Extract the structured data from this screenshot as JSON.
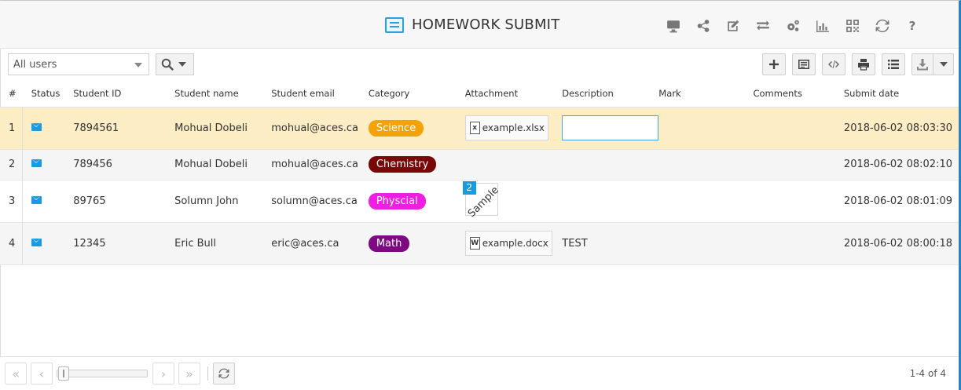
{
  "header": {
    "title": "HOMEWORK SUBMIT",
    "icons": [
      "monitor-icon",
      "share-icon",
      "edit-icon",
      "swap-icon",
      "settings-icon",
      "chart-icon",
      "qrcode-icon",
      "refresh-icon",
      "help-icon"
    ],
    "help_label": "?"
  },
  "toolbar": {
    "user_filter": "All users",
    "right_buttons": [
      "add-icon",
      "form-icon",
      "code-icon",
      "print-icon",
      "list-icon",
      "download-icon"
    ]
  },
  "table": {
    "columns": [
      "#",
      "Status",
      "Student ID",
      "Student name",
      "Student email",
      "Category",
      "Attachment",
      "Description",
      "Mark",
      "Comments",
      "Submit date"
    ],
    "rows": [
      {
        "num": "1",
        "status": "mail-icon",
        "student_id": "7894561",
        "name": "Mohual Dobeli",
        "email": "mohual@aces.ca",
        "category": "Science",
        "category_color": "#f5a20a",
        "attachment": "example.xlsx",
        "attachment_type": "x",
        "description": "",
        "mark": "",
        "comments": "",
        "date": "2018-06-02 08:03:30"
      },
      {
        "num": "2",
        "status": "mail-icon",
        "student_id": "789456",
        "name": "Mohual Dobeli",
        "email": "mohual@aces.ca",
        "category": "Chemistry",
        "category_color": "#7a0707",
        "attachment": "",
        "description": "",
        "mark": "",
        "comments": "",
        "date": "2018-06-02 08:02:10"
      },
      {
        "num": "3",
        "status": "mail-icon",
        "student_id": "89765",
        "name": "Solumn John",
        "email": "solumn@aces.ca",
        "category": "Physcial",
        "category_color": "#f01ee2",
        "attachment_count": "2",
        "attachment_sample": "Sample",
        "description": "",
        "mark": "",
        "comments": "",
        "date": "2018-06-02 08:01:09"
      },
      {
        "num": "4",
        "status": "mail-icon",
        "student_id": "12345",
        "name": "Eric Bull",
        "email": "eric@aces.ca",
        "category": "Math",
        "category_color": "#7e0a82",
        "attachment": "example.docx",
        "attachment_type": "W",
        "description": "TEST",
        "mark": "",
        "comments": "",
        "date": "2018-06-02 08:00:18"
      }
    ]
  },
  "pager": {
    "info": "1-4 of 4"
  }
}
